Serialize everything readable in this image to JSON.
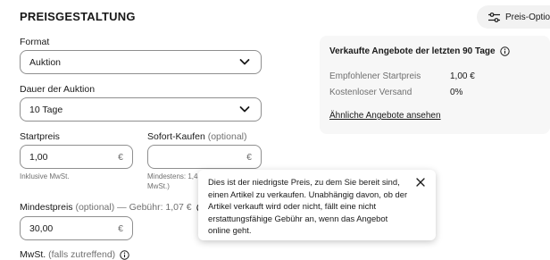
{
  "section": {
    "title": "PREISGESTALTUNG"
  },
  "price_options_button": {
    "label": "Preis-Optionen",
    "icon": "sliders-icon"
  },
  "format": {
    "label": "Format",
    "value": "Auktion"
  },
  "duration": {
    "label": "Dauer der Auktion",
    "value": "10 Tage"
  },
  "start_price": {
    "label": "Startpreis",
    "value": "1,00",
    "currency": "€",
    "hint": "Inklusive MwSt."
  },
  "buy_now": {
    "label": "Sofort-Kaufen",
    "optional": "(optional)",
    "currency": "€",
    "hint_line1": "Mindestens: 1,4",
    "hint_line2": "MwSt.)"
  },
  "min_price": {
    "label": "Mindestpreis",
    "optional": "(optional)",
    "fee": "— Gebühr: 1,07 €",
    "value": "30,00",
    "currency": "€"
  },
  "vat": {
    "label": "MwSt.",
    "note": "(falls zutreffend)"
  },
  "sold_panel": {
    "title": "Verkaufte Angebote der letzten 90 Tage",
    "stats": [
      {
        "label": "Empfohlener Startpreis",
        "value": "1,00 €"
      },
      {
        "label": "Kostenloser Versand",
        "value": "0%"
      }
    ],
    "link": "Ähnliche Angebote ansehen"
  },
  "tooltip": {
    "text": "Dies ist der niedrigste Preis, zu dem Sie bereit sind, einen Artikel zu verkaufen. Unabhängig davon, ob der Artikel verkauft wird oder nicht, fällt eine nicht erstattungsfähige Gebühr an, wenn das Angebot online geht."
  }
}
